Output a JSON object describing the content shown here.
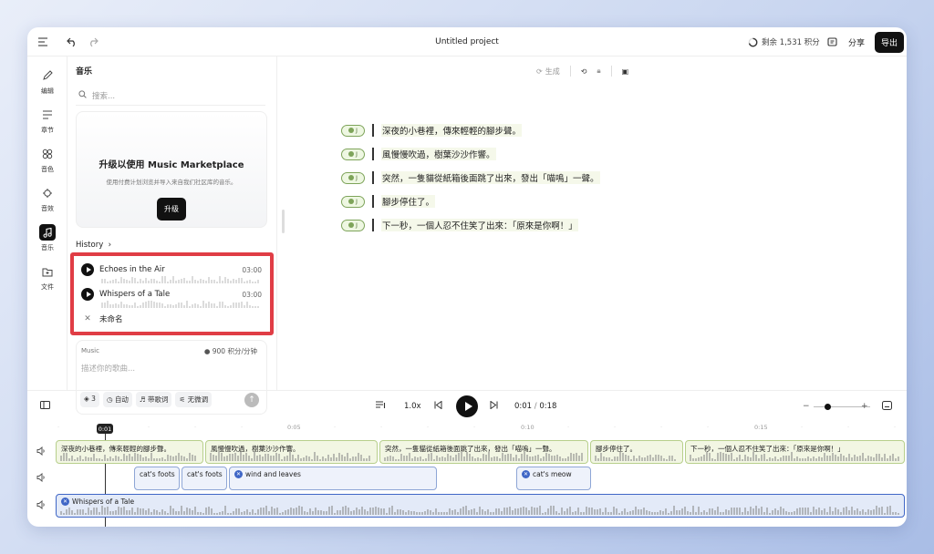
{
  "topbar": {
    "title": "Untitled project",
    "credits": "剩余 1,531 积分",
    "share": "分享",
    "export": "导出"
  },
  "rail": [
    {
      "label": "编辑",
      "icon": "edit-icon"
    },
    {
      "label": "章节",
      "icon": "chapters-icon"
    },
    {
      "label": "音色",
      "icon": "voices-icon"
    },
    {
      "label": "音效",
      "icon": "sound-effects-icon"
    },
    {
      "label": "音乐",
      "icon": "music-icon",
      "active": true
    },
    {
      "label": "文件",
      "icon": "files-icon"
    }
  ],
  "panel": {
    "title": "音乐",
    "search_placeholder": "搜索...",
    "upgrade": {
      "title": "升级以使用 Music Marketplace",
      "subtitle": "使用付费计划浏览并导入来自我们社区库的音乐。",
      "button": "升级"
    },
    "history_label": "History",
    "history": [
      {
        "name": "Echoes in the Air",
        "duration": "03:00"
      },
      {
        "name": "Whispers of a Tale",
        "duration": "03:00"
      },
      {
        "name": "未命名"
      }
    ],
    "generate": {
      "label": "Music",
      "cost": "900 积分/分钟",
      "placeholder": "描述你的歌曲...",
      "chips": [
        "3",
        "自动",
        "带歌词",
        "无微调"
      ]
    }
  },
  "editor": {
    "toolbar_generate": "生成",
    "lines": [
      "深夜的小巷裡，傳來輕輕的腳步聲。",
      "風慢慢吹過，樹葉沙沙作響。",
      "突然，一隻貓從紙箱後面跳了出來，發出「喵嗚」一聲。",
      "腳步停住了。",
      "下一秒，一個人忍不住笑了出來：「原來是你啊！」"
    ]
  },
  "transport": {
    "speed": "1.0x",
    "current": "0:01",
    "total": "0:18"
  },
  "timeline": {
    "ruler": [
      "0:05",
      "0:10",
      "0:15"
    ],
    "playhead": "0:01",
    "voice_clips": [
      "深夜的小巷裡，傳來輕輕的腳步聲。",
      "風慢慢吹過，樹葉沙沙作響。",
      "突然，一隻貓從紙箱後面跳了出來，發出「喵嗚」一聲。",
      "腳步停住了。",
      "下一秒，一個人忍不住笑了出來：「原來是你啊！」"
    ],
    "sfx_clips": [
      "cat's foots",
      "cat's foots",
      "wind and leaves",
      "cat's meow"
    ],
    "music_clip": "Whispers of a Tale"
  }
}
